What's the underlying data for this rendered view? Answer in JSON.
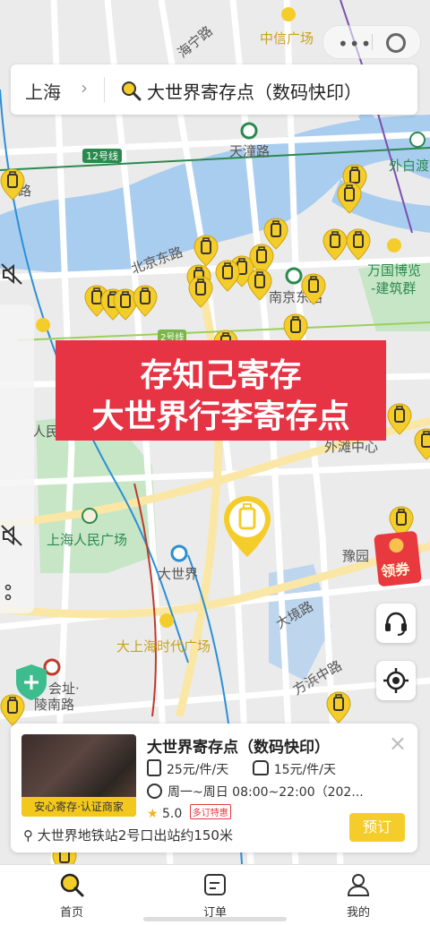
{
  "map": {
    "labels": [
      "海宁路",
      "中信广场",
      "天潼路",
      "外白渡",
      "12号线",
      "北京东路",
      "万国博览",
      "-建筑群",
      "南京东路",
      "人民广场",
      "外滩中心",
      "上海人民广场",
      "大世界",
      "豫园",
      "大境路",
      "大上海时代广场",
      "方浜中路",
      "会址·",
      "陵南路",
      "2号线",
      "路"
    ],
    "colors": {
      "water": "#a9cdef",
      "park": "#c7e6c5",
      "road": "#ffffff",
      "major_road": "#fbe7a5",
      "pin": "#f5cd2b"
    }
  },
  "search": {
    "city": "上海",
    "city_arrow": "chevron-right-icon",
    "query": "大世界寄存点（数码快印）",
    "icon": "search-icon"
  },
  "capsule": {
    "more": "•••"
  },
  "banner": {
    "line1": "存知己寄存",
    "line2": "大世界行李寄存点"
  },
  "promo": {
    "label": "领券"
  },
  "card": {
    "title": "大世界寄存点（数码快印）",
    "thumb_caption": "安心寄存·认证商家",
    "price_luggage": "25元/件/天",
    "price_bag": "15元/件/天",
    "hours": "周一~周日 08:00~22:00（202...",
    "rating": "5.0",
    "rating_badge": "多订特惠",
    "location": "大世界地铁站2号口出站约150米",
    "book_label": "预订",
    "close": "×"
  },
  "tabs": [
    {
      "label": "首页",
      "icon": "search-icon",
      "active": true
    },
    {
      "label": "订单",
      "icon": "order-icon",
      "active": false
    },
    {
      "label": "我的",
      "icon": "profile-icon",
      "active": false
    }
  ]
}
